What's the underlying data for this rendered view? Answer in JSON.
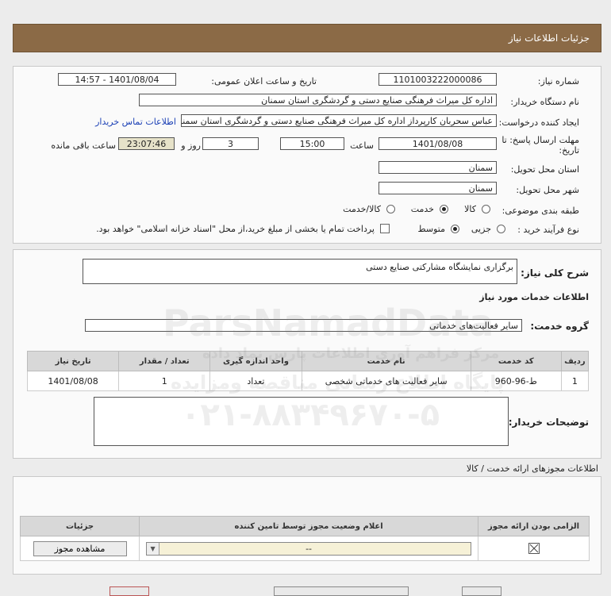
{
  "header": {
    "title": "جزئیات اطلاعات نیاز"
  },
  "form": {
    "need_number_label": "شماره نیاز:",
    "need_number_value": "1101003222000086",
    "announce_label": "تاریخ و ساعت اعلان عمومی:",
    "announce_value": "1401/08/04 - 14:57",
    "buyer_org_label": "نام دستگاه خریدار:",
    "buyer_org_value": "اداره کل میراث فرهنگی  صنایع دستی و گردشگری استان سمنان",
    "creator_label": "ایجاد کننده درخواست:",
    "creator_value": "عباس سحربان کارپرداز اداره کل میراث فرهنگی  صنایع دستی و گردشگری استان سمنان",
    "contact_link": "اطلاعات تماس خریدار",
    "deadline_label_1": "مهلت ارسال پاسخ: تا",
    "deadline_label_2": "تاریخ:",
    "deadline_date": "1401/08/08",
    "time_label": "ساعت",
    "deadline_time": "15:00",
    "days_value": "3",
    "days_label": "روز و",
    "remaining_value": "23:07:46",
    "remaining_label": "ساعت باقی مانده",
    "province_label": "استان محل تحویل:",
    "province_value": "سمنان",
    "city_label": "شهر محل تحویل:",
    "city_value": "سمنان",
    "category_label": "طبقه بندی موضوعی:",
    "category_options": [
      "کالا",
      "خدمت",
      "کالا/خدمت"
    ],
    "category_selected": "خدمت",
    "process_label": "نوع فرآیند خرید :",
    "process_options": [
      "جزیی",
      "متوسط"
    ],
    "process_selected": "متوسط",
    "payment_note": "پرداخت تمام یا بخشی از مبلغ خرید،از محل \"اسناد خزانه اسلامی\" خواهد بود."
  },
  "summary": {
    "desc_label": "شرح کلی نیاز:",
    "desc_value": "برگزاری نمایشگاه مشارکتی صنایع دستی",
    "services_heading": "اطلاعات خدمات مورد نیاز",
    "group_label": "گروه خدمت:",
    "group_value": "سایر فعالیت‌های خدماتی",
    "table": {
      "headers": [
        "ردیف",
        "کد خدمت",
        "نام خدمت",
        "واحد اندازه گیری",
        "تعداد / مقدار",
        "تاریخ نیاز"
      ],
      "rows": [
        [
          "1",
          "ط-96-960",
          "سایر فعالیت های خدماتی شخصی",
          "تعداد",
          "1",
          "1401/08/08"
        ]
      ]
    },
    "buyer_notes_label": "توضیحات خریدار:"
  },
  "licenses": {
    "heading": "اطلاعات مجوزهای ارائه خدمت / کالا",
    "headers": [
      "الزامی بودن ارائه مجوز",
      "اعلام وضعیت مجوز توسط تامین کننده",
      "جزئیات"
    ],
    "status_value": "--",
    "view_button": "مشاهده مجوز"
  },
  "watermark": {
    "text1": "ParsNamadData",
    "text2": "۰۲۱-۸۸۳۴۹۶۷۰-۵",
    "text3": "پایگاه اطلاع رسانی مناقصه ومزایده",
    "text4": "مرکز فراهم آوری اطلاعات پارس نماد داده"
  }
}
